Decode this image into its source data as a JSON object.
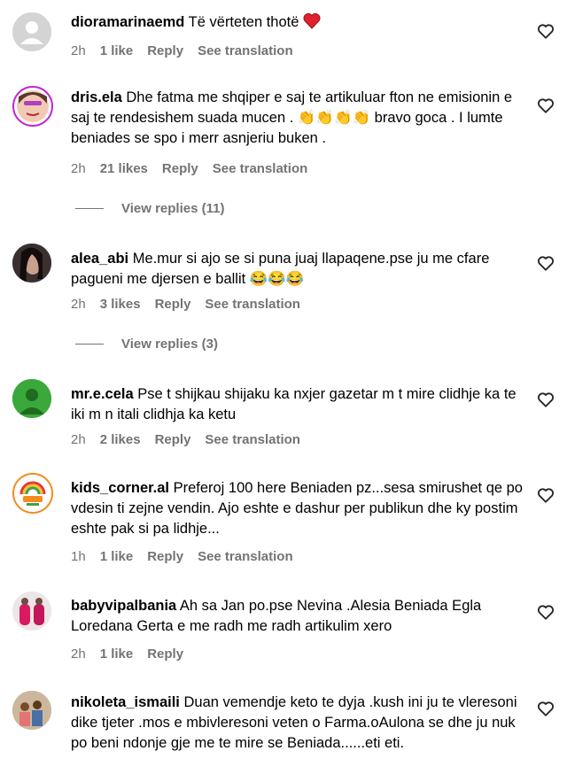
{
  "comments": [
    {
      "username": "dioramarinaemd",
      "text": "Të vërteten thotë",
      "time": "2h",
      "likes": "1 like",
      "reply": "Reply",
      "translate": "See translation"
    },
    {
      "username": "dris.ela",
      "text": "Dhe fatma me shqiper e saj te artikuluar fton ne emisionin e saj te rendesishem suada mucen . 👏👏👏👏 bravo goca . I lumte beniades se spo i merr asnjeriu buken .",
      "time": "2h",
      "likes": "21 likes",
      "reply": "Reply",
      "translate": "See translation",
      "view_replies": "View replies (11)"
    },
    {
      "username": "alea_abi",
      "text": "Me.mur si ajo se si puna juaj llapaqene.pse ju me cfare pagueni me djersen e ballit 😂😂😂",
      "time": "2h",
      "likes": "3 likes",
      "reply": "Reply",
      "translate": "See translation",
      "view_replies": "View replies (3)"
    },
    {
      "username": "mr.e.cela",
      "text": "Pse t shijkau shijaku ka nxjer gazetar m t mire clidhje ka te iki m n itali clidhja ka ketu",
      "time": "2h",
      "likes": "2 likes",
      "reply": "Reply",
      "translate": "See translation"
    },
    {
      "username": "kids_corner.al",
      "text": "Preferoj 100 here Beniaden pz...sesa smirushet qe po vdesin ti zejne vendin. Ajo eshte e dashur per publikun dhe ky postim eshte pak si pa lidhje...",
      "time": "1h",
      "likes": "1 like",
      "reply": "Reply",
      "translate": "See translation"
    },
    {
      "username": "babyvipalbania",
      "text": "Ah sa Jan po.pse Nevina .Alesia Beniada Egla Loredana Gerta e me radh me radh artikulim xero",
      "time": "2h",
      "likes": "1 like",
      "reply": "Reply"
    },
    {
      "username": "nikoleta_ismaili",
      "text": "Duan vemendje keto te dyja .kush ini ju te vleresoni dike tjeter .mos e mbivleresoni veten o Farma.oAulona se dhe ju nuk po beni ndonje gje me te mire se Beniada......eti eti."
    }
  ],
  "icons": {
    "like": "heart-outline-icon",
    "emoji_clap": "clapping-hands",
    "emoji_laugh": "tears-of-joy",
    "emoji_heart": "red-heart"
  }
}
